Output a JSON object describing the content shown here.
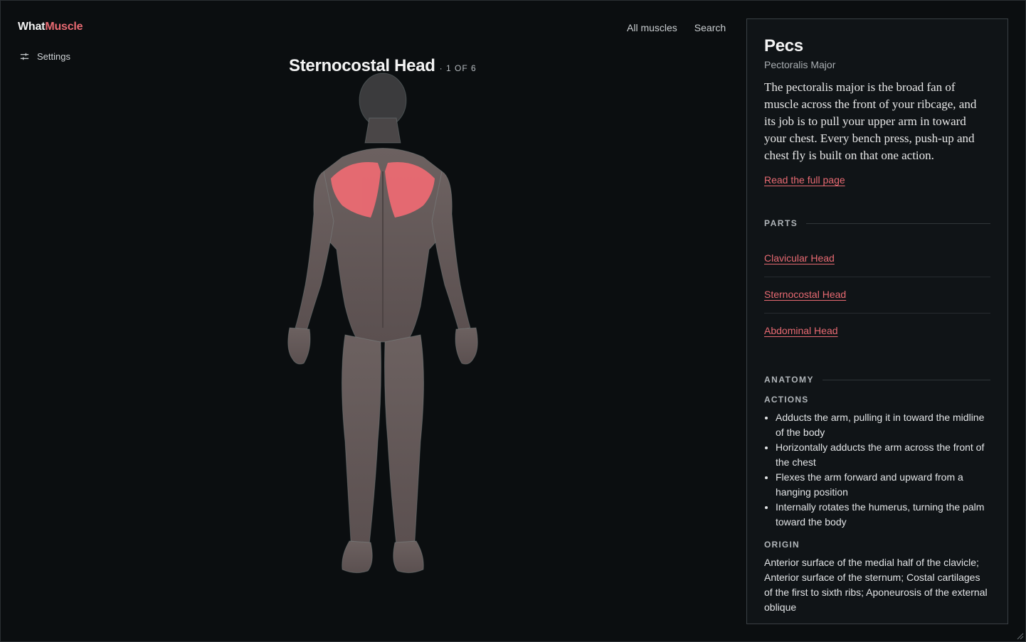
{
  "app": {
    "logo_part1": "What",
    "logo_part2": "Muscle",
    "settings_label": "Settings"
  },
  "nav": {
    "all_muscles": "All muscles",
    "search": "Search"
  },
  "figure": {
    "part_name": "Sternocostal Head",
    "count": "· 1 OF 6"
  },
  "panel": {
    "title": "Pecs",
    "subtitle": "Pectoralis Major",
    "description": "The pectoralis major is the broad fan of muscle across the front of your ribcage, and its job is to pull your upper arm in toward your chest. Every bench press, push-up and chest fly is built on that one action.",
    "read_more": "Read the full page",
    "parts_heading": "PARTS",
    "parts": [
      {
        "label": "Clavicular Head"
      },
      {
        "label": "Sternocostal Head"
      },
      {
        "label": "Abdominal Head"
      }
    ],
    "anatomy_heading": "ANATOMY",
    "actions_heading": "ACTIONS",
    "actions": [
      "Adducts the arm, pulling it in toward the midline of the body",
      "Horizontally adducts the arm across the front of the chest",
      "Flexes the arm forward and upward from a hanging position",
      "Internally rotates the humerus, turning the palm toward the body"
    ],
    "origin_heading": "ORIGIN",
    "origin": "Anterior surface of the medial half of the clavicle; Anterior surface of the sternum; Costal cartilages of the first to sixth ribs; Aponeurosis of the external oblique"
  },
  "colors": {
    "accent": "#e86a72",
    "background": "#0b0e10",
    "panel": "#101417",
    "muscle": "#6e5f5e",
    "highlight": "#ef6b73"
  }
}
